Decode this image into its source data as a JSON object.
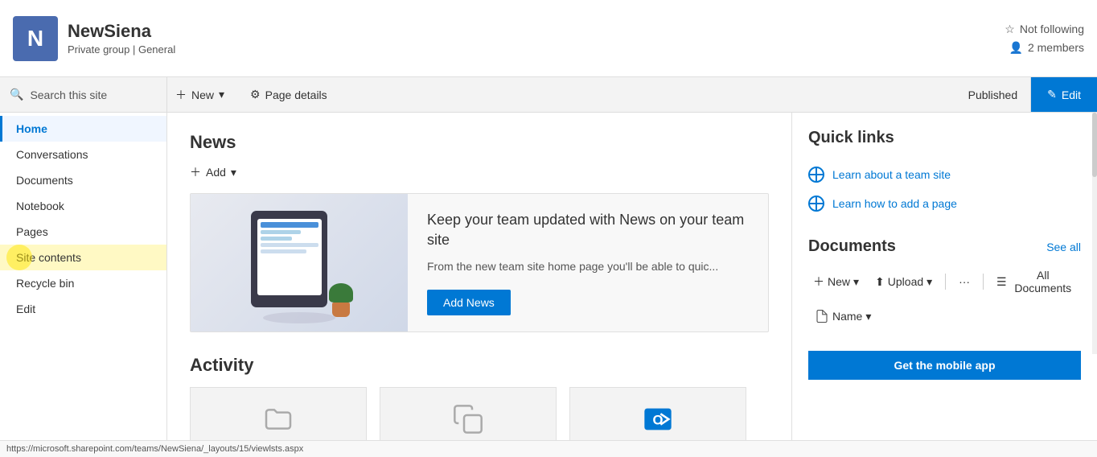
{
  "site": {
    "logo_letter": "N",
    "title": "NewSiena",
    "subtitle_private": "Private group",
    "subtitle_separator": "|",
    "subtitle_general": "General"
  },
  "top_right": {
    "not_following_label": "Not following",
    "members_label": "2 members"
  },
  "toolbar": {
    "new_label": "New",
    "page_details_label": "Page details",
    "published_label": "Published",
    "edit_label": "Edit"
  },
  "search": {
    "placeholder": "Search this site"
  },
  "sidebar": {
    "items": [
      {
        "label": "Home",
        "active": true
      },
      {
        "label": "Conversations",
        "active": false
      },
      {
        "label": "Documents",
        "active": false
      },
      {
        "label": "Notebook",
        "active": false
      },
      {
        "label": "Pages",
        "active": false
      },
      {
        "label": "Site contents",
        "active": false,
        "highlighted": true
      },
      {
        "label": "Recycle bin",
        "active": false
      },
      {
        "label": "Edit",
        "active": false
      }
    ]
  },
  "news": {
    "title": "News",
    "add_label": "Add",
    "headline": "Keep your team updated with News on your team site",
    "description": "From the new team site home page you'll be able to quic...",
    "add_news_btn": "Add News"
  },
  "activity": {
    "title": "Activity"
  },
  "quick_links": {
    "title": "Quick links",
    "items": [
      {
        "label": "Learn about a team site"
      },
      {
        "label": "Learn how to add a page"
      }
    ]
  },
  "documents": {
    "title": "Documents",
    "see_all": "See all",
    "new_btn": "New",
    "upload_btn": "Upload",
    "more_btn": "···",
    "all_docs_btn": "All Documents",
    "name_header": "Name"
  },
  "mobile_banner": {
    "label": "Get the mobile app"
  },
  "status_bar": {
    "url": "https://microsoft.sharepoint.com/teams/NewSiena/_layouts/15/viewlsts.aspx"
  }
}
